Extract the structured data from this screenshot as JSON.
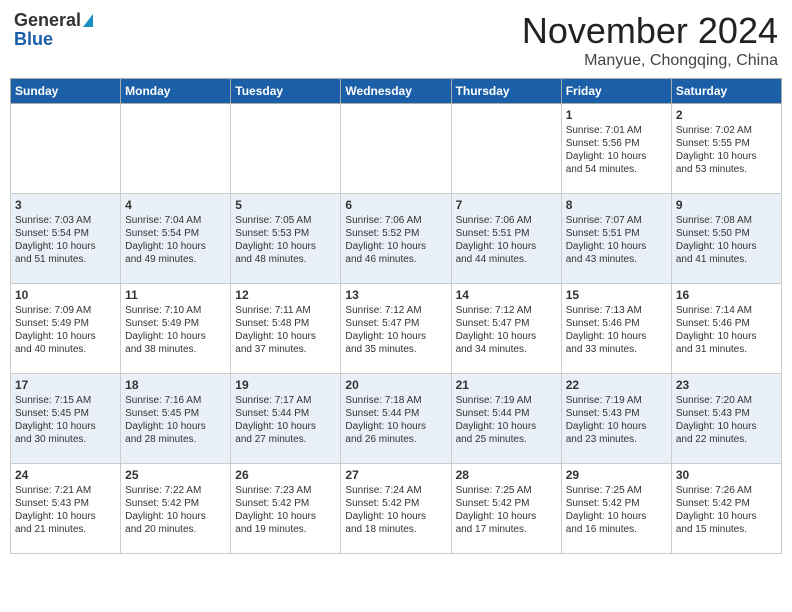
{
  "header": {
    "logo_general": "General",
    "logo_blue": "Blue",
    "month_title": "November 2024",
    "location": "Manyue, Chongqing, China"
  },
  "weekdays": [
    "Sunday",
    "Monday",
    "Tuesday",
    "Wednesday",
    "Thursday",
    "Friday",
    "Saturday"
  ],
  "weeks": [
    [
      {
        "day": "",
        "info": ""
      },
      {
        "day": "",
        "info": ""
      },
      {
        "day": "",
        "info": ""
      },
      {
        "day": "",
        "info": ""
      },
      {
        "day": "",
        "info": ""
      },
      {
        "day": "1",
        "info": "Sunrise: 7:01 AM\nSunset: 5:56 PM\nDaylight: 10 hours\nand 54 minutes."
      },
      {
        "day": "2",
        "info": "Sunrise: 7:02 AM\nSunset: 5:55 PM\nDaylight: 10 hours\nand 53 minutes."
      }
    ],
    [
      {
        "day": "3",
        "info": "Sunrise: 7:03 AM\nSunset: 5:54 PM\nDaylight: 10 hours\nand 51 minutes."
      },
      {
        "day": "4",
        "info": "Sunrise: 7:04 AM\nSunset: 5:54 PM\nDaylight: 10 hours\nand 49 minutes."
      },
      {
        "day": "5",
        "info": "Sunrise: 7:05 AM\nSunset: 5:53 PM\nDaylight: 10 hours\nand 48 minutes."
      },
      {
        "day": "6",
        "info": "Sunrise: 7:06 AM\nSunset: 5:52 PM\nDaylight: 10 hours\nand 46 minutes."
      },
      {
        "day": "7",
        "info": "Sunrise: 7:06 AM\nSunset: 5:51 PM\nDaylight: 10 hours\nand 44 minutes."
      },
      {
        "day": "8",
        "info": "Sunrise: 7:07 AM\nSunset: 5:51 PM\nDaylight: 10 hours\nand 43 minutes."
      },
      {
        "day": "9",
        "info": "Sunrise: 7:08 AM\nSunset: 5:50 PM\nDaylight: 10 hours\nand 41 minutes."
      }
    ],
    [
      {
        "day": "10",
        "info": "Sunrise: 7:09 AM\nSunset: 5:49 PM\nDaylight: 10 hours\nand 40 minutes."
      },
      {
        "day": "11",
        "info": "Sunrise: 7:10 AM\nSunset: 5:49 PM\nDaylight: 10 hours\nand 38 minutes."
      },
      {
        "day": "12",
        "info": "Sunrise: 7:11 AM\nSunset: 5:48 PM\nDaylight: 10 hours\nand 37 minutes."
      },
      {
        "day": "13",
        "info": "Sunrise: 7:12 AM\nSunset: 5:47 PM\nDaylight: 10 hours\nand 35 minutes."
      },
      {
        "day": "14",
        "info": "Sunrise: 7:12 AM\nSunset: 5:47 PM\nDaylight: 10 hours\nand 34 minutes."
      },
      {
        "day": "15",
        "info": "Sunrise: 7:13 AM\nSunset: 5:46 PM\nDaylight: 10 hours\nand 33 minutes."
      },
      {
        "day": "16",
        "info": "Sunrise: 7:14 AM\nSunset: 5:46 PM\nDaylight: 10 hours\nand 31 minutes."
      }
    ],
    [
      {
        "day": "17",
        "info": "Sunrise: 7:15 AM\nSunset: 5:45 PM\nDaylight: 10 hours\nand 30 minutes."
      },
      {
        "day": "18",
        "info": "Sunrise: 7:16 AM\nSunset: 5:45 PM\nDaylight: 10 hours\nand 28 minutes."
      },
      {
        "day": "19",
        "info": "Sunrise: 7:17 AM\nSunset: 5:44 PM\nDaylight: 10 hours\nand 27 minutes."
      },
      {
        "day": "20",
        "info": "Sunrise: 7:18 AM\nSunset: 5:44 PM\nDaylight: 10 hours\nand 26 minutes."
      },
      {
        "day": "21",
        "info": "Sunrise: 7:19 AM\nSunset: 5:44 PM\nDaylight: 10 hours\nand 25 minutes."
      },
      {
        "day": "22",
        "info": "Sunrise: 7:19 AM\nSunset: 5:43 PM\nDaylight: 10 hours\nand 23 minutes."
      },
      {
        "day": "23",
        "info": "Sunrise: 7:20 AM\nSunset: 5:43 PM\nDaylight: 10 hours\nand 22 minutes."
      }
    ],
    [
      {
        "day": "24",
        "info": "Sunrise: 7:21 AM\nSunset: 5:43 PM\nDaylight: 10 hours\nand 21 minutes."
      },
      {
        "day": "25",
        "info": "Sunrise: 7:22 AM\nSunset: 5:42 PM\nDaylight: 10 hours\nand 20 minutes."
      },
      {
        "day": "26",
        "info": "Sunrise: 7:23 AM\nSunset: 5:42 PM\nDaylight: 10 hours\nand 19 minutes."
      },
      {
        "day": "27",
        "info": "Sunrise: 7:24 AM\nSunset: 5:42 PM\nDaylight: 10 hours\nand 18 minutes."
      },
      {
        "day": "28",
        "info": "Sunrise: 7:25 AM\nSunset: 5:42 PM\nDaylight: 10 hours\nand 17 minutes."
      },
      {
        "day": "29",
        "info": "Sunrise: 7:25 AM\nSunset: 5:42 PM\nDaylight: 10 hours\nand 16 minutes."
      },
      {
        "day": "30",
        "info": "Sunrise: 7:26 AM\nSunset: 5:42 PM\nDaylight: 10 hours\nand 15 minutes."
      }
    ]
  ]
}
